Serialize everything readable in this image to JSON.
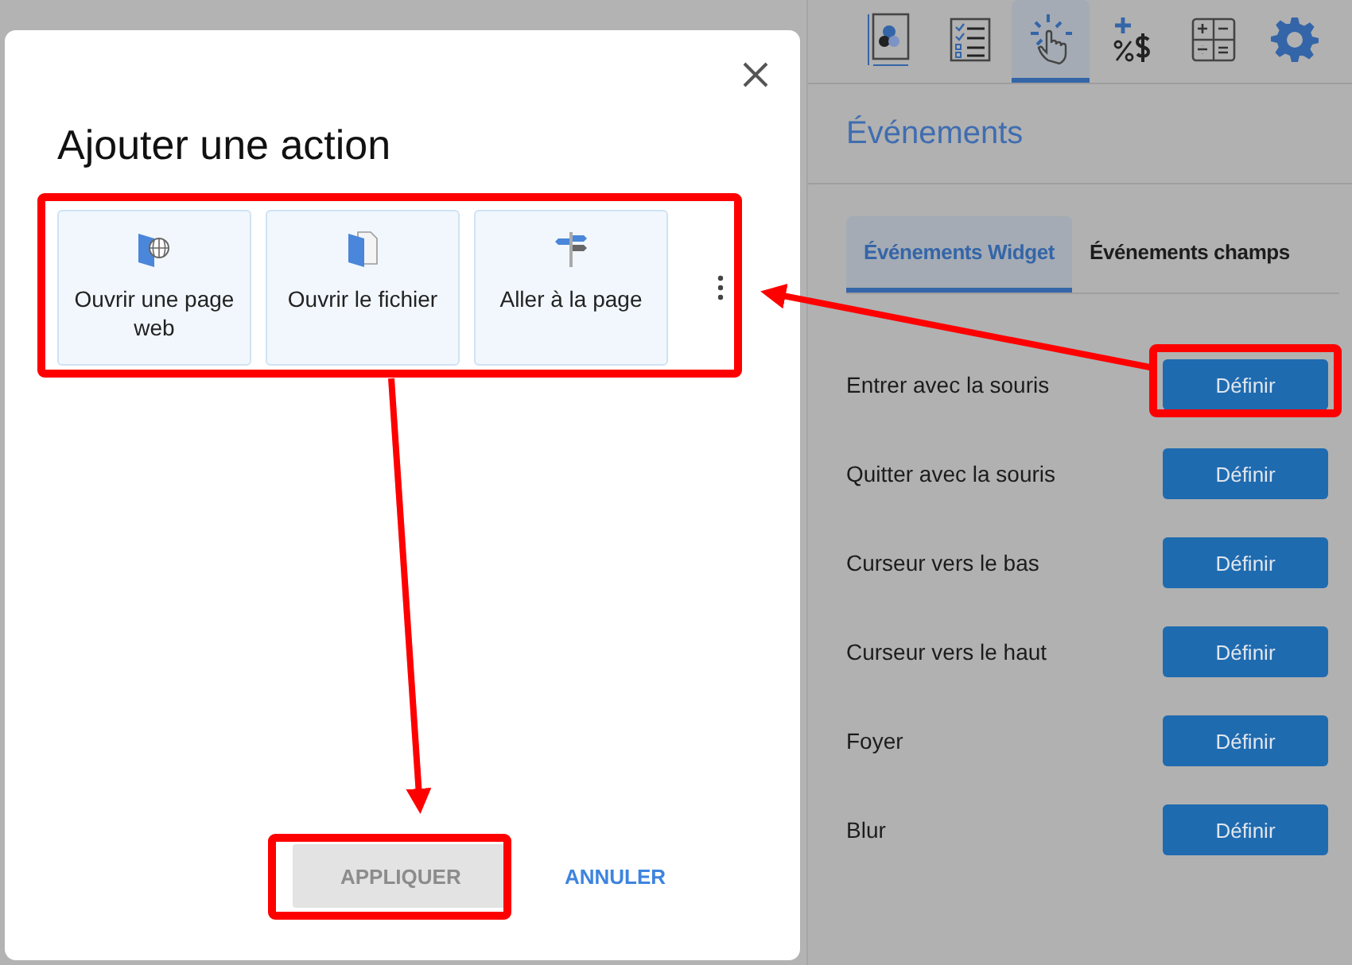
{
  "dialog": {
    "title": "Ajouter une action",
    "actions": [
      {
        "kind": "web",
        "label": "Ouvrir une page web"
      },
      {
        "kind": "file",
        "label": "Ouvrir le fichier"
      },
      {
        "kind": "goto",
        "label": "Aller à la page"
      }
    ],
    "buttons": [
      {
        "label": "APPLIQUER",
        "disabled": true
      },
      {
        "label": "ANNULER",
        "disabled": false
      }
    ]
  },
  "panel": {
    "toolbar": [
      {
        "kind": "layout",
        "selected": false
      },
      {
        "kind": "checklist",
        "selected": false
      },
      {
        "kind": "click",
        "selected": true
      },
      {
        "kind": "format",
        "selected": false
      },
      {
        "kind": "calc",
        "selected": false
      },
      {
        "kind": "settings",
        "selected": false
      }
    ],
    "title": "Événements",
    "tabs": [
      {
        "label": "Événements Widget",
        "selected": true
      },
      {
        "label": "Événements champs",
        "selected": false
      }
    ],
    "events": [
      {
        "label": "Entrer avec la souris",
        "button": "Définir"
      },
      {
        "label": "Quitter avec la souris",
        "button": "Définir"
      },
      {
        "label": "Curseur vers le bas",
        "button": "Définir"
      },
      {
        "label": "Curseur vers le haut",
        "button": "Définir"
      },
      {
        "label": "Foyer",
        "button": "Définir"
      },
      {
        "label": "Blur",
        "button": "Définir"
      }
    ]
  }
}
